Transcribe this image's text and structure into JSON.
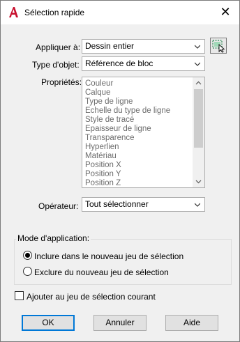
{
  "window": {
    "title": "Sélection rapide",
    "close_glyph": "✕"
  },
  "form": {
    "apply_to": {
      "label": "Appliquer à:",
      "value": "Dessin entier"
    },
    "object_type": {
      "label": "Type d'objet:",
      "value": "Référence de bloc"
    },
    "properties": {
      "label": "Propriétés:",
      "items": [
        "Couleur",
        "Calque",
        "Type de ligne",
        "Echelle du type de ligne",
        "Style de tracé",
        "Epaisseur de ligne",
        "Transparence",
        "Hyperlien",
        "Matériau",
        "Position X",
        "Position Y",
        "Position Z"
      ]
    },
    "operator": {
      "label": "Opérateur:",
      "value": "Tout sélectionner"
    }
  },
  "mode": {
    "title": "Mode d'application:",
    "include_label": "Inclure dans le nouveau jeu de sélection",
    "exclude_label": "Exclure du nouveau jeu de sélection",
    "selected": "include"
  },
  "append_checkbox": {
    "label": "Ajouter au jeu de sélection courant",
    "checked": false
  },
  "buttons": {
    "ok": "OK",
    "cancel": "Annuler",
    "help": "Aide"
  },
  "colors": {
    "accent": "#0078d7",
    "autocad_red": "#c8102e",
    "select_icon_green": "#2e8b57"
  },
  "icons": {
    "app": "autocad-icon",
    "pick": "select-objects-icon"
  }
}
